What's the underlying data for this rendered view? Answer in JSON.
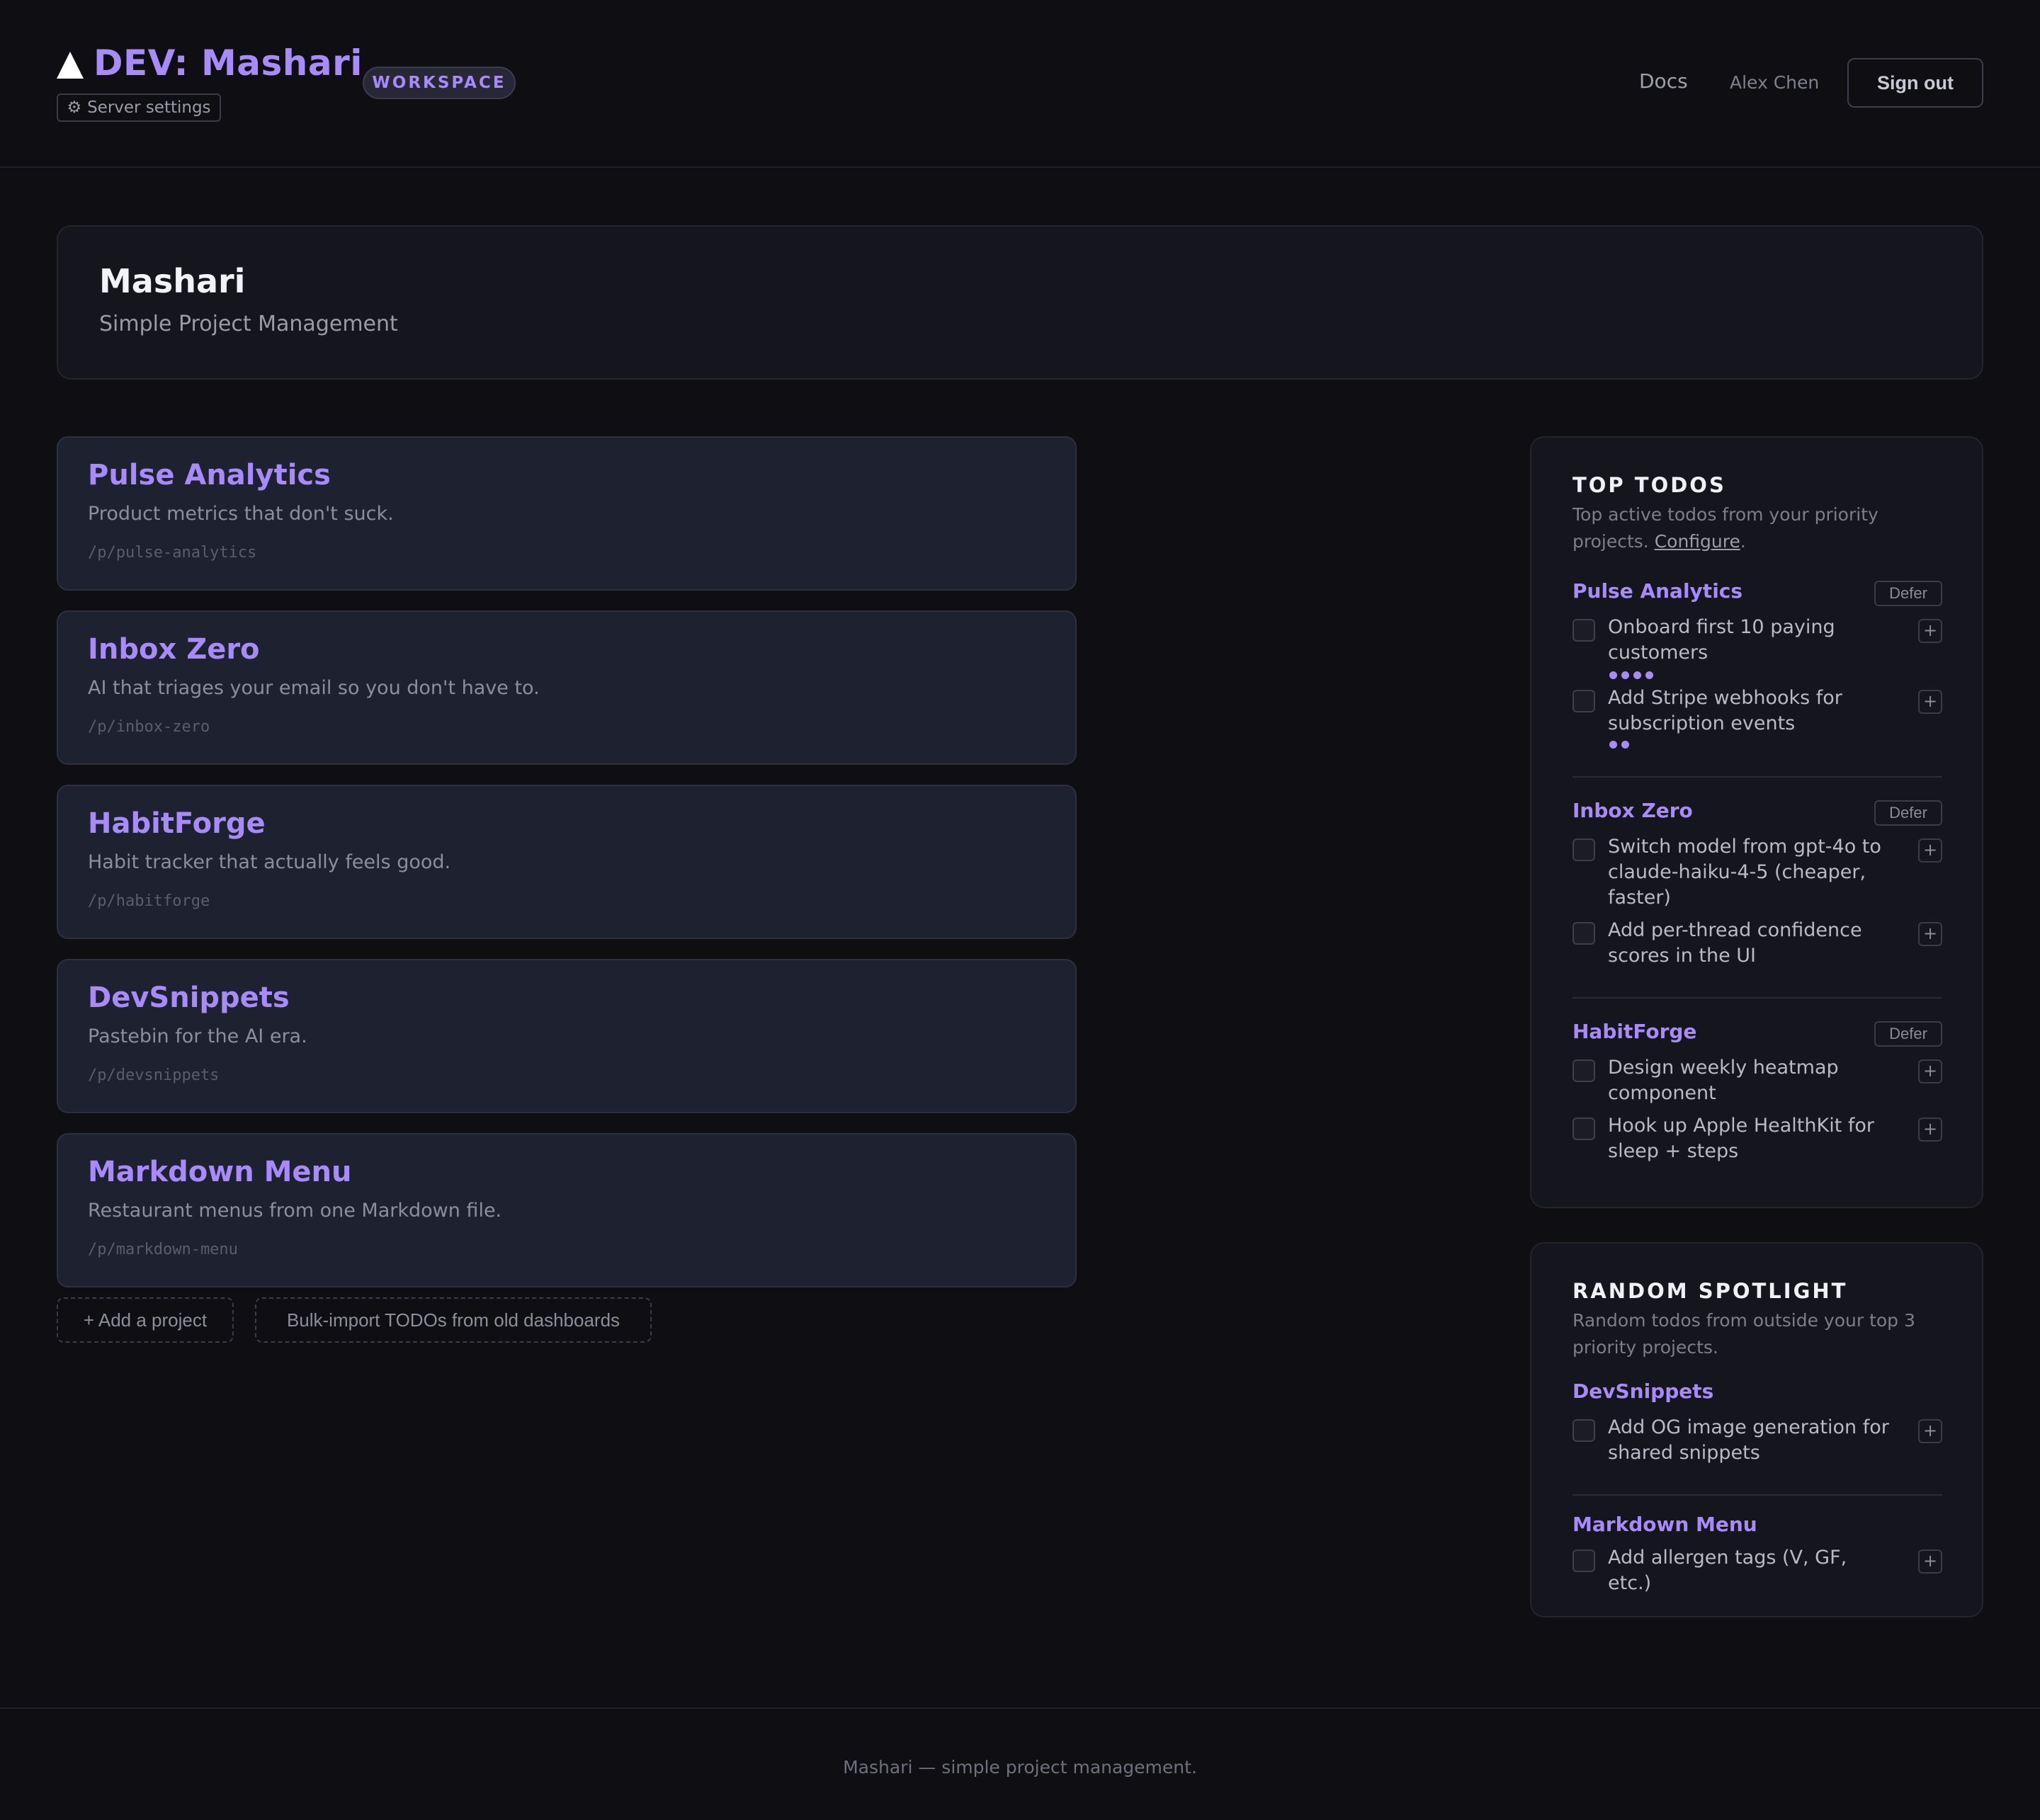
{
  "header": {
    "title": "DEV: Mashari",
    "logo_icon": "triangle-logo-icon",
    "workspace_badge": "WORKSPACE",
    "server_settings_icon": "⚙",
    "server_settings": "Server settings",
    "nav_docs": "Docs",
    "user_name": "Alex Chen",
    "sign_out": "Sign out"
  },
  "hero": {
    "title": "Mashari",
    "subtitle": "Simple Project Management"
  },
  "projects": [
    {
      "name": "Pulse Analytics",
      "description": "Product metrics that don't suck.",
      "slug": "/p/pulse-analytics"
    },
    {
      "name": "Inbox Zero",
      "description": "AI that triages your email so you don't have to.",
      "slug": "/p/inbox-zero"
    },
    {
      "name": "HabitForge",
      "description": "Habit tracker that actually feels good.",
      "slug": "/p/habitforge"
    },
    {
      "name": "DevSnippets",
      "description": "Pastebin for the AI era.",
      "slug": "/p/devsnippets"
    },
    {
      "name": "Markdown Menu",
      "description": "Restaurant menus from one Markdown file.",
      "slug": "/p/markdown-menu"
    }
  ],
  "actions": {
    "add_project": "+ Add a project",
    "bulk_import": "Bulk-import TODOs from old dashboards"
  },
  "top_todos": {
    "title": "TOP TODOS",
    "desc_before": "Top active todos from your priority projects. ",
    "desc_link": "Configure",
    "desc_after": ".",
    "defer_label": "Defer",
    "plus_label": "+",
    "groups": [
      {
        "project": "Pulse Analytics",
        "todos": [
          {
            "text": "Onboard first 10 paying customers",
            "priority": 4
          },
          {
            "text": "Add Stripe webhooks for subscription events",
            "priority": 2
          }
        ]
      },
      {
        "project": "Inbox Zero",
        "todos": [
          {
            "text": "Switch model from gpt-4o to claude-haiku-4-5 (cheaper, faster)",
            "priority": 0
          },
          {
            "text": "Add per-thread confidence scores in the UI",
            "priority": 0
          }
        ]
      },
      {
        "project": "HabitForge",
        "todos": [
          {
            "text": "Design weekly heatmap component",
            "priority": 0
          },
          {
            "text": "Hook up Apple HealthKit for sleep + steps",
            "priority": 0
          }
        ]
      }
    ]
  },
  "random_spotlight": {
    "title": "RANDOM SPOTLIGHT",
    "description": "Random todos from outside your top 3 priority projects.",
    "plus_label": "+",
    "groups": [
      {
        "project": "DevSnippets",
        "todos": [
          {
            "text": "Add OG image generation for shared snippets"
          }
        ]
      },
      {
        "project": "Markdown Menu",
        "todos": [
          {
            "text": "Add allergen tags (V, GF, etc.)"
          }
        ]
      }
    ]
  },
  "footer": {
    "text": "Mashari — simple project management."
  },
  "colors": {
    "accent": "#a78bfa",
    "background": "#0e0e13",
    "card": "#1e2230",
    "panel": "#14151d"
  }
}
